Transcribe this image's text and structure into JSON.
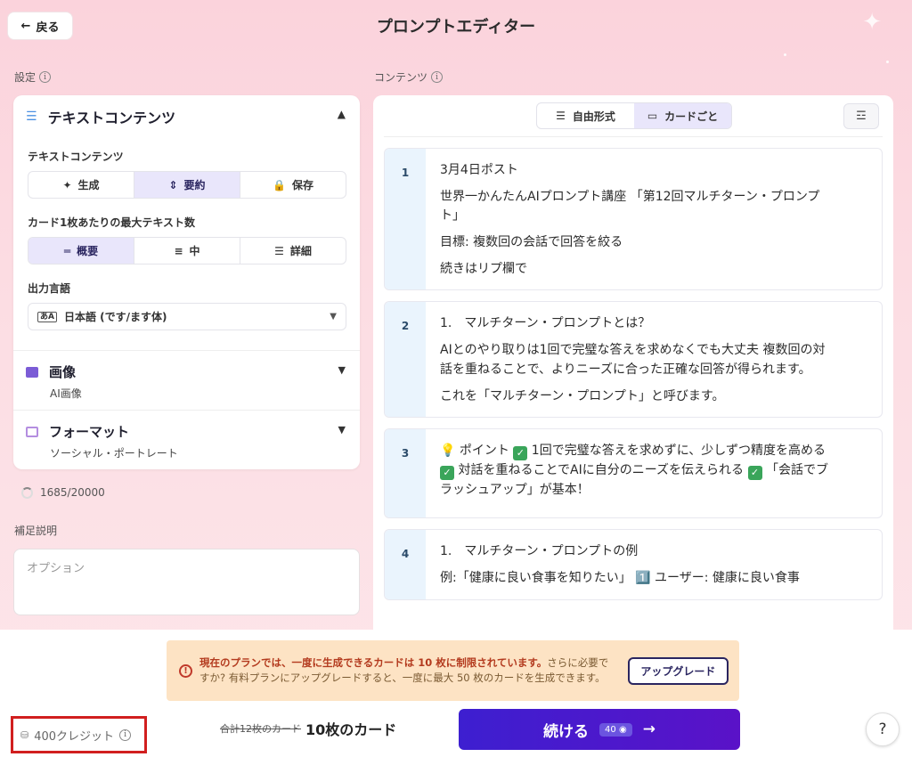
{
  "header": {
    "back_label": "戻る",
    "title": "プロンプトエディター"
  },
  "settings": {
    "label": "設定",
    "text_section": {
      "title": "テキストコンテンツ",
      "mode_label": "テキストコンテンツ",
      "modes": [
        "生成",
        "要約",
        "保存"
      ],
      "mode_selected": "要約",
      "max_text_label": "カード1枚あたりの最大テキスト数",
      "lengths": [
        "概要",
        "中",
        "詳細"
      ],
      "length_selected": "概要",
      "output_lang_label": "出力言語",
      "output_lang_value": "日本語 (です/ます体)"
    },
    "image_section": {
      "title": "画像",
      "value": "AI画像"
    },
    "format_section": {
      "title": "フォーマット",
      "value": "ソーシャル・ポートレート"
    },
    "char_count": "1685/20000",
    "note_label": "補足説明",
    "note_placeholder": "オプション"
  },
  "content": {
    "label": "コンテンツ",
    "view_modes": [
      "自由形式",
      "カードごと"
    ],
    "view_selected": "カードごと",
    "cards": [
      {
        "num": "1",
        "lines": [
          "3月4日ポスト",
          "世界一かんたんAIプロンプト講座 「第12回マルチターン・プロンプト」",
          "目標: 複数回の会話で回答を絞る",
          "続きはリプ欄で"
        ]
      },
      {
        "num": "2",
        "lines": [
          "1.　マルチターン・プロンプトとは？",
          "AIとのやり取りは1回で完璧な答えを求めなくでも大丈夫 複数回の対話を重ねることで、よりニーズに合った正確な回答が得られます。",
          "これを「マルチターン・プロンプト」と呼びます。"
        ]
      },
      {
        "num": "3",
        "parts": [
          "💡 ポイント",
          "1回で完璧な答えを求めずに、少しずつ精度を高める",
          "対話を重ねることでAIに自分のニーズを伝えられる",
          "「会話でブラッシュアップ」が基本！"
        ]
      },
      {
        "num": "4",
        "lines": [
          "1.　マルチターン・プロンプトの例",
          "例:「健康に良い食事を知りたい」 1️⃣ ユーザー: 健康に良い食事"
        ]
      }
    ]
  },
  "footer": {
    "notice_bold": "現在のプランでは、一度に生成できるカードは 10 枚に制限されています。",
    "notice_rest": "さらに必要ですか? 有料プランにアップグレードすると、一度に最大 50 枚のカードを生成できます。",
    "upgrade_label": "アップグレード",
    "credits": "400クレジット",
    "total_strike": "合計12枚のカード",
    "card_count": "10枚のカード",
    "continue_label": "続ける",
    "continue_cost": "40",
    "help_label": "?"
  },
  "colors": {
    "accent": "#3d1fd0",
    "selected_bg": "#e9e6fb",
    "warning_bg": "#fde3c4",
    "highlight_border": "#d11f1f"
  }
}
